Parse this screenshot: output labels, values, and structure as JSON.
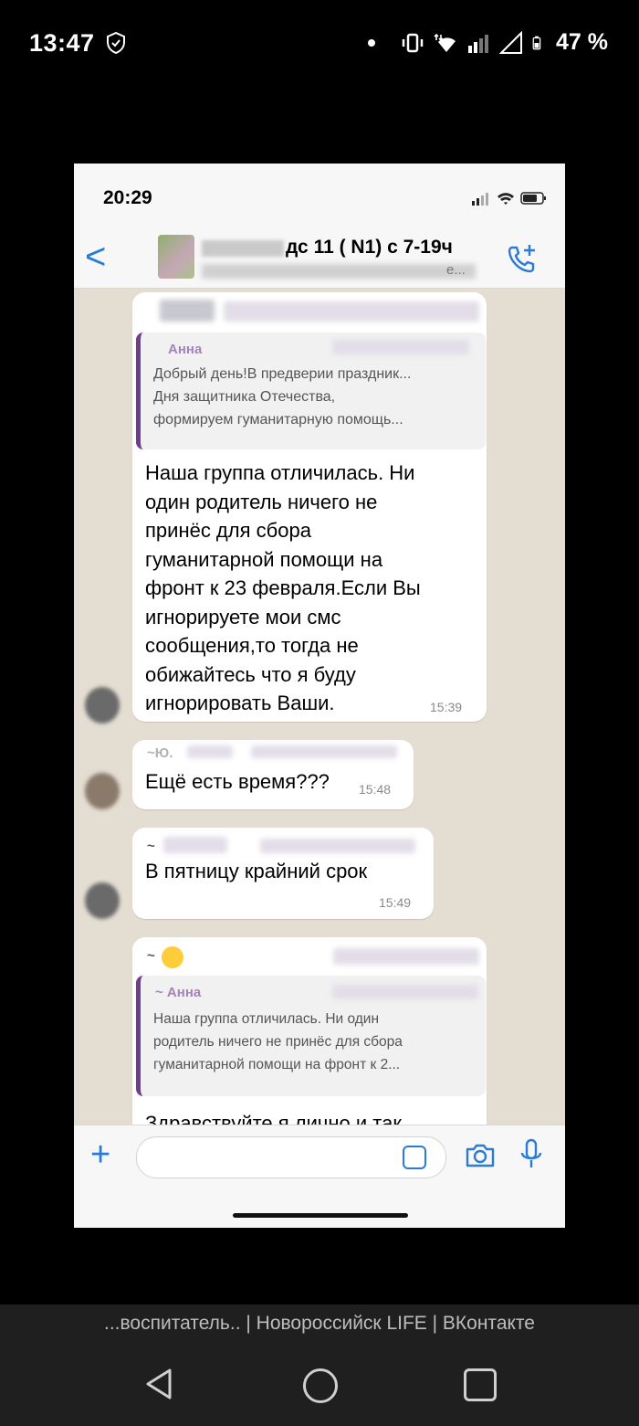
{
  "status_bar": {
    "time": "13:47",
    "battery": "47 %"
  },
  "screenshot": {
    "status_time": "20:29",
    "header": {
      "back_label": "<",
      "title": "дс 11 ( N1) с 7-19ч",
      "subtitle": "е..."
    },
    "messages": [
      {
        "quote_name": "Анна",
        "quote_text": "Добрый день!В предверии праздник...\nДня защитника Отечества,\n формируем гуманитарную помощь...",
        "text": "Наша группа отличилась. Ни\nодин родитель ничего не\nпринёс для сбора\nгуманитарной помощи на\nфронт к 23 февраля.Если Вы\nигнорируете мои смс\nсообщения,то тогда не\nобижайтесь что я буду\nигнорировать Ваши.",
        "time": "15:39"
      },
      {
        "sender": "~Ю.",
        "text": "Ещё есть время???",
        "time": "15:48"
      },
      {
        "sender": "~",
        "text": "В пятницу крайний срок",
        "time": "15:49"
      },
      {
        "sender": "~",
        "quote_name": "~ Анна",
        "quote_text": "Наша группа отличилась. Ни один\nродитель ничего не принёс для сбора\nгуманитарной помощи на фронт к 2...",
        "text": "Здравствуйте я лично и так"
      }
    ],
    "composer": {
      "placeholder": ""
    }
  },
  "caption": "...воспитатель.. | Новороссийск LIFE | ВКонтакте",
  "colors": {
    "accent": "#2a7bd8",
    "quote_bar": "#6f3c8e",
    "chat_bg": "#e4ddd2"
  }
}
